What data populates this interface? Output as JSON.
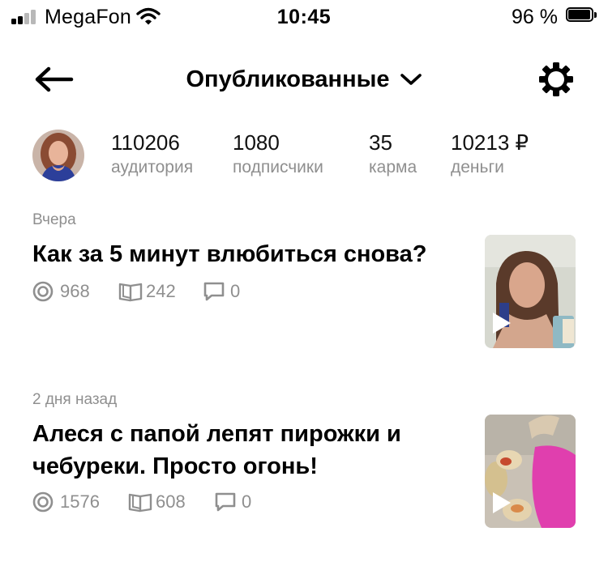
{
  "status_bar": {
    "carrier": "MegaFon",
    "time": "10:45",
    "battery_percent": "96 %"
  },
  "header": {
    "title": "Опубликованные",
    "back_icon": "arrow-left-icon",
    "dropdown_icon": "chevron-down-icon",
    "settings_icon": "gear-icon"
  },
  "stats": [
    {
      "value": "110206",
      "label": "аудитория"
    },
    {
      "value": "1080",
      "label": "подписчики"
    },
    {
      "value": "35",
      "label": "карма"
    },
    {
      "value": "10213 ₽",
      "label": "деньги"
    }
  ],
  "articles": [
    {
      "date": "Вчера",
      "title": "Как за 5 минут влюбиться снова?",
      "views": "968",
      "reads": "242",
      "comments": "0",
      "thumbnail_type": "video"
    },
    {
      "date": "2 дня назад",
      "title": "Алеся с папой лепят пирожки и чебуреки. Просто огонь!",
      "views": "1576",
      "reads": "608",
      "comments": "0",
      "thumbnail_type": "video"
    }
  ],
  "colors": {
    "text": "#000000",
    "secondary_text": "#8f8f8f",
    "background": "#ffffff"
  }
}
